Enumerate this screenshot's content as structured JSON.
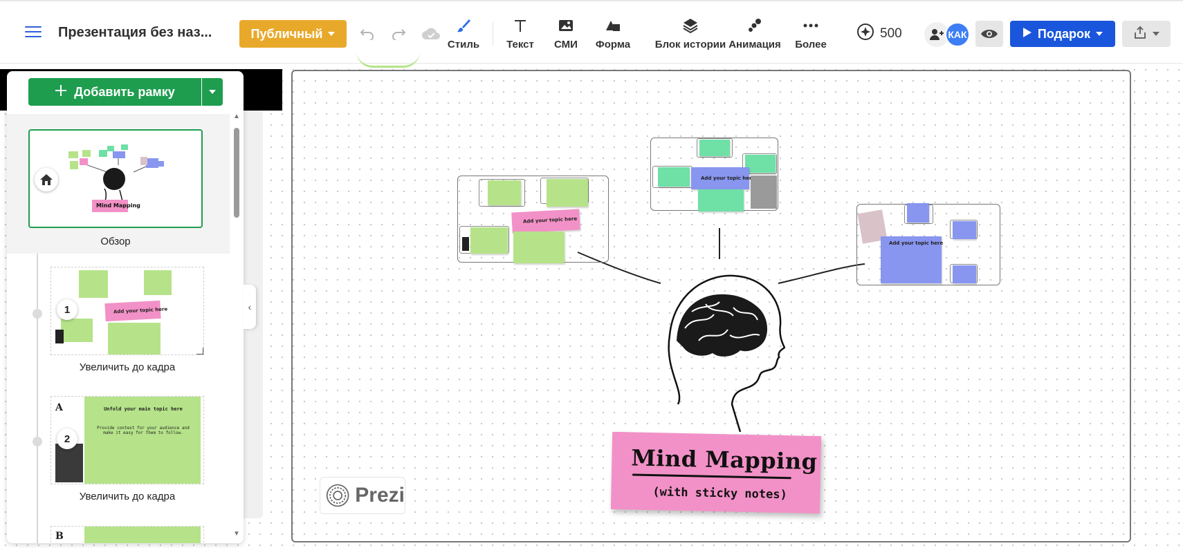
{
  "topbar": {
    "title": "Презентация без наз...",
    "visibility_label": "Публичный",
    "tools": {
      "style": "Стиль",
      "text": "Текст",
      "media": "СМИ",
      "shape": "Форма",
      "story": "Блок истории",
      "animation": "Анимация",
      "more": "Более"
    },
    "credits": "500",
    "avatar_initials": "КАК",
    "present_label": "Подарок"
  },
  "frames_panel": {
    "add_frame_label": "Добавить рамку",
    "items": [
      {
        "label": "Обзор"
      },
      {
        "label": "Увеличить до кадра",
        "step": "1"
      },
      {
        "label": "Увеличить до кадра",
        "step": "2"
      }
    ],
    "thumb2": {
      "letter": "A",
      "heading": "Unfold your main topic here",
      "body": "Provide context for your audience and make it easy for them to follow."
    },
    "thumb1_note": "Add your topic here",
    "thumb3_letter": "B"
  },
  "canvas": {
    "topic_label": "Add your topic here",
    "title": "Mind Mapping",
    "subtitle": "(with sticky notes)",
    "logo_text": "Prezi"
  },
  "colors": {
    "accent_blue": "#1a56db",
    "public_yellow": "#e8a92b",
    "frame_green": "#1e9d4f",
    "note_pink": "#f291c7",
    "note_green": "#b6e38a",
    "note_mint": "#6fe0a6",
    "note_blue": "#8896f0"
  },
  "icons": [
    "menu-icon",
    "undo-icon",
    "redo-icon",
    "cloud-icon",
    "brush-icon",
    "text-icon",
    "image-icon",
    "shapes-icon",
    "layers-icon",
    "animation-icon",
    "more-icon",
    "credits-icon",
    "add-user-icon",
    "eye-icon",
    "play-icon",
    "export-icon",
    "plus-icon",
    "home-icon",
    "chevron-left-icon"
  ]
}
